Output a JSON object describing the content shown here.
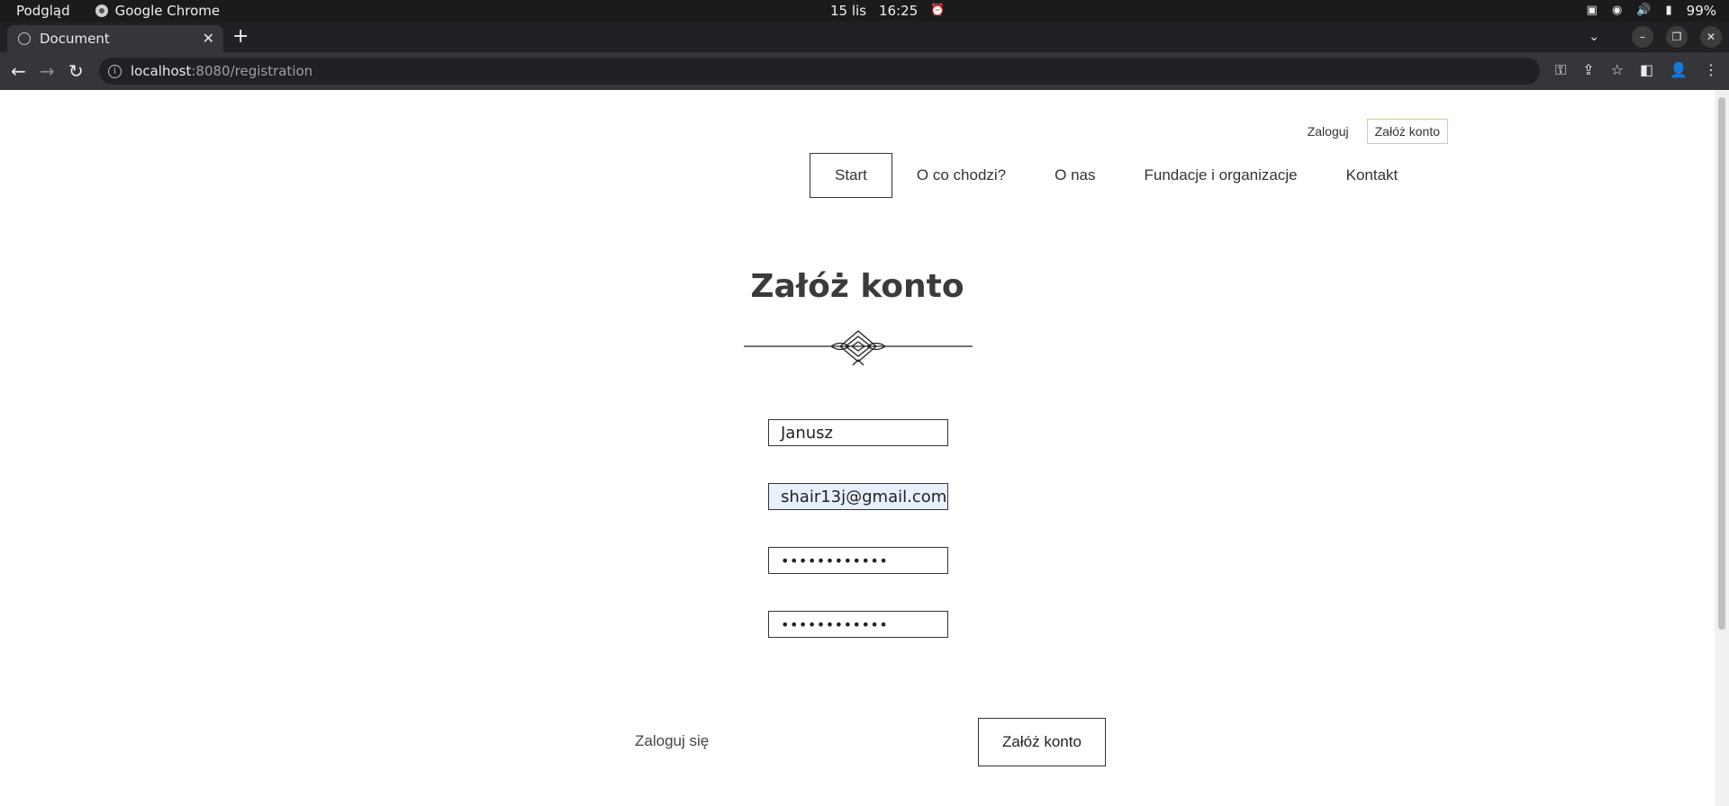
{
  "os": {
    "app_menu": "Podgląd",
    "browser_name": "Google Chrome",
    "date": "15 lis",
    "time": "16:25",
    "battery": "99%"
  },
  "browser": {
    "tab_title": "Document",
    "url_host": "localhost",
    "url_path": ":8080/registration"
  },
  "header": {
    "login_label": "Zaloguj",
    "register_label": "Załóż konto",
    "nav": [
      "Start",
      "O co chodzi?",
      "O nas",
      "Fundacje i organizacje",
      "Kontakt"
    ]
  },
  "form": {
    "title": "Załóż konto",
    "name_value": "Janusz",
    "email_value": "shair13j@gmail.com",
    "password_value": "••••••••••••",
    "password_repeat_value": "••••••••••••",
    "login_link": "Zaloguj się",
    "submit_label": "Załóż konto"
  },
  "colors": {
    "register_border": "#f2c94c",
    "autofill_bg": "#e8f0fe"
  }
}
